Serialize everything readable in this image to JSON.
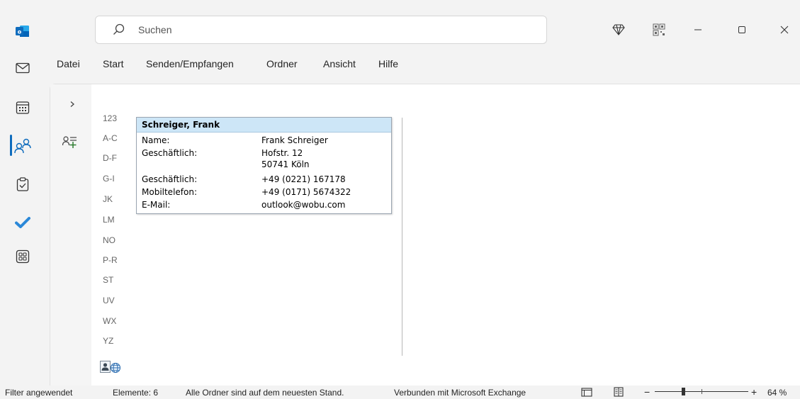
{
  "search": {
    "placeholder": "Suchen"
  },
  "menu": [
    "Datei",
    "Start",
    "Senden/Empfangen",
    "Ordner",
    "Ansicht",
    "Hilfe"
  ],
  "rail_icons": [
    "outlook-logo-icon",
    "mail-icon",
    "calendar-icon",
    "people-icon",
    "tasks-icon",
    "todo-icon",
    "apps-icon"
  ],
  "alphabet_index": [
    "123",
    "A-C",
    "D-F",
    "G-I",
    "JK",
    "LM",
    "NO",
    "P-R",
    "ST",
    "UV",
    "WX",
    "YZ"
  ],
  "contact_card": {
    "title": "Schreiger, Frank",
    "rows": [
      {
        "label": "Name:",
        "value": "Frank Schreiger"
      },
      {
        "label": "Geschäftlich:",
        "value": "Hofstr. 12"
      },
      {
        "label": "",
        "value": "50741 Köln"
      },
      {
        "label": "Geschäftlich:",
        "value": "+49 (0221) 167178"
      },
      {
        "label": "Mobiltelefon:",
        "value": "+49 (0171) 5674322"
      },
      {
        "label": "E-Mail:",
        "value": "outlook@wobu.com"
      }
    ]
  },
  "status": {
    "filter": "Filter angewendet",
    "elements": "Elemente: 6",
    "sync": "Alle Ordner sind auf dem neuesten Stand.",
    "connection": "Verbunden mit Microsoft Exchange",
    "zoom": "64 %",
    "zoom_value": 64
  },
  "colors": {
    "accent": "#0f6cbd",
    "card_header": "#cde6f7",
    "outlook_blue": "#0364b8"
  }
}
